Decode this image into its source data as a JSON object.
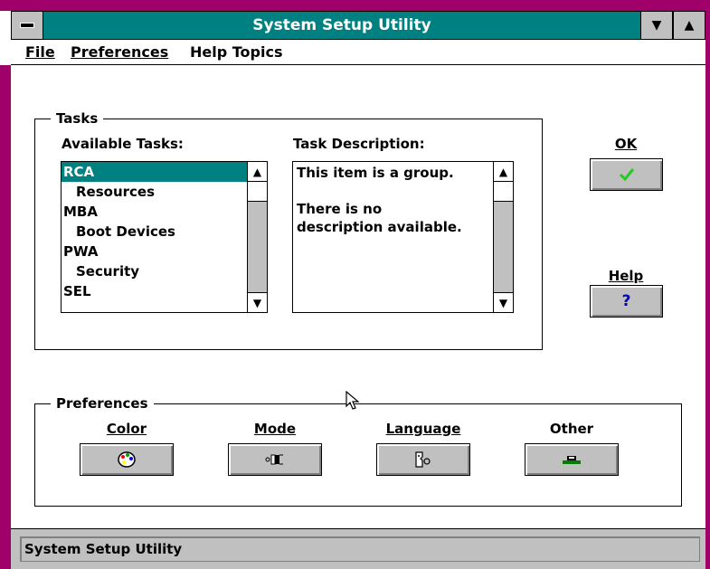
{
  "window": {
    "title": "System Setup Utility",
    "system_menu_icon": "system-menu-icon",
    "minimize_glyph": "▼",
    "maximize_glyph": "▲"
  },
  "menubar": {
    "items": [
      {
        "label": "File",
        "mnemonic_index": 0
      },
      {
        "label": "Preferences",
        "mnemonic_index": 0
      },
      {
        "label": "Help Topics",
        "mnemonic_index": 5
      }
    ]
  },
  "tasks": {
    "group_title": "Tasks",
    "available_label": "Available Tasks:",
    "description_label": "Task Description:",
    "list_items": [
      {
        "label": "RCA",
        "child": false,
        "selected": true
      },
      {
        "label": "Resources",
        "child": true,
        "selected": false
      },
      {
        "label": "MBA",
        "child": false,
        "selected": false
      },
      {
        "label": "Boot Devices",
        "child": true,
        "selected": false
      },
      {
        "label": "PWA",
        "child": false,
        "selected": false
      },
      {
        "label": "Security",
        "child": true,
        "selected": false
      },
      {
        "label": "SEL",
        "child": false,
        "selected": false
      }
    ],
    "description_text": "This item is a group.\n\nThere is no\ndescription available.",
    "scroll_up_glyph": "▲",
    "scroll_down_glyph": "▼"
  },
  "buttons": {
    "ok_label": "OK",
    "ok_icon": "checkmark-icon",
    "help_label": "Help",
    "help_glyph": "?"
  },
  "preferences": {
    "group_title": "Preferences",
    "items": [
      {
        "label": "Color",
        "icon": "palette-icon"
      },
      {
        "label": "Mode",
        "icon": "mode-icon"
      },
      {
        "label": "Language",
        "icon": "language-icon"
      },
      {
        "label": "Other",
        "icon": "other-icon"
      }
    ]
  },
  "status": {
    "text": "System Setup Utility"
  },
  "colors": {
    "titlebar": "#008080",
    "frame": "#a0006a",
    "selection": "#008080",
    "check": "#22cc22",
    "help_q": "#0000c0"
  }
}
